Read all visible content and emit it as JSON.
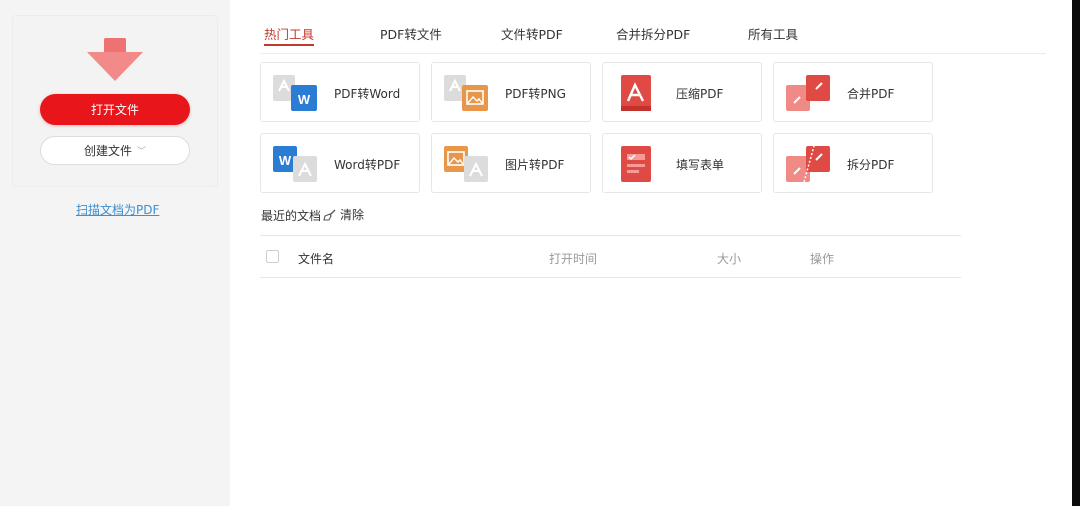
{
  "sidebar": {
    "open_file_label": "打开文件",
    "create_file_label": "创建文件",
    "create_file_chevron": "﹀",
    "scan_link_label": "扫描文档为PDF",
    "hero_icon": "download-arrow-icon"
  },
  "tabs": [
    {
      "label": "热门工具",
      "active": true
    },
    {
      "label": "PDF转文件",
      "active": false
    },
    {
      "label": "文件转PDF",
      "active": false
    },
    {
      "label": "合并拆分PDF",
      "active": false
    },
    {
      "label": "所有工具",
      "active": false
    }
  ],
  "tools": [
    {
      "label": "PDF转Word",
      "icon": "pdf-to-word-icon"
    },
    {
      "label": "PDF转PNG",
      "icon": "pdf-to-png-icon"
    },
    {
      "label": "压缩PDF",
      "icon": "compress-pdf-icon"
    },
    {
      "label": "合并PDF",
      "icon": "merge-pdf-icon"
    },
    {
      "label": "Word转PDF",
      "icon": "word-to-pdf-icon"
    },
    {
      "label": "图片转PDF",
      "icon": "image-to-pdf-icon"
    },
    {
      "label": "填写表单",
      "icon": "fill-form-icon"
    },
    {
      "label": "拆分PDF",
      "icon": "split-pdf-icon"
    }
  ],
  "recent": {
    "title": "最近的文档",
    "clear_label": "清除",
    "columns": {
      "name": "文件名",
      "opened": "打开时间",
      "size": "大小",
      "action": "操作"
    }
  },
  "colors": {
    "primary_red": "#e8151b",
    "active_tab": "#c23a2c",
    "link_blue": "#3d8fcf",
    "word_blue": "#2b7cd3",
    "image_orange": "#e8964a",
    "pdf_red": "#e04a45"
  }
}
